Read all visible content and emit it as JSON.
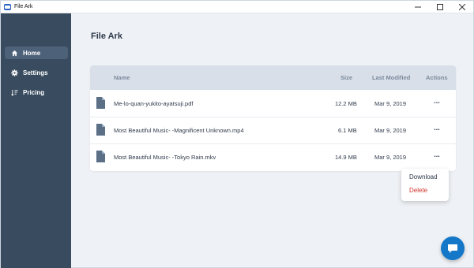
{
  "window": {
    "title": "File Ark"
  },
  "sidebar": {
    "items": [
      {
        "label": "Home",
        "icon": "home-icon",
        "active": true
      },
      {
        "label": "Settings",
        "icon": "gear-icon",
        "active": false
      },
      {
        "label": "Pricing",
        "icon": "sort-icon",
        "active": false
      }
    ]
  },
  "main": {
    "title": "File Ark",
    "table": {
      "columns": [
        "Name",
        "Size",
        "Last Modified",
        "Actions"
      ],
      "rows": [
        {
          "name": "Me-lo-quan-yukito-ayatsuji.pdf",
          "size": "12.2 MB",
          "modified": "Mar 9, 2019",
          "actions": "..."
        },
        {
          "name": "Most Beautiful Music- -Magnificent Unknown.mp4",
          "size": "6.1 MB",
          "modified": "Mar 9, 2019",
          "actions": "..."
        },
        {
          "name": "Most Beautiful Music- -Tokyo Rain.mkv",
          "size": "14.9 MB",
          "modified": "Mar 9, 2019",
          "actions": "..."
        }
      ]
    },
    "context_menu": {
      "download": "Download",
      "delete": "Delete"
    }
  },
  "colors": {
    "sidebar": "#384b5f",
    "accent": "#1477c8",
    "danger": "#d0342c"
  }
}
